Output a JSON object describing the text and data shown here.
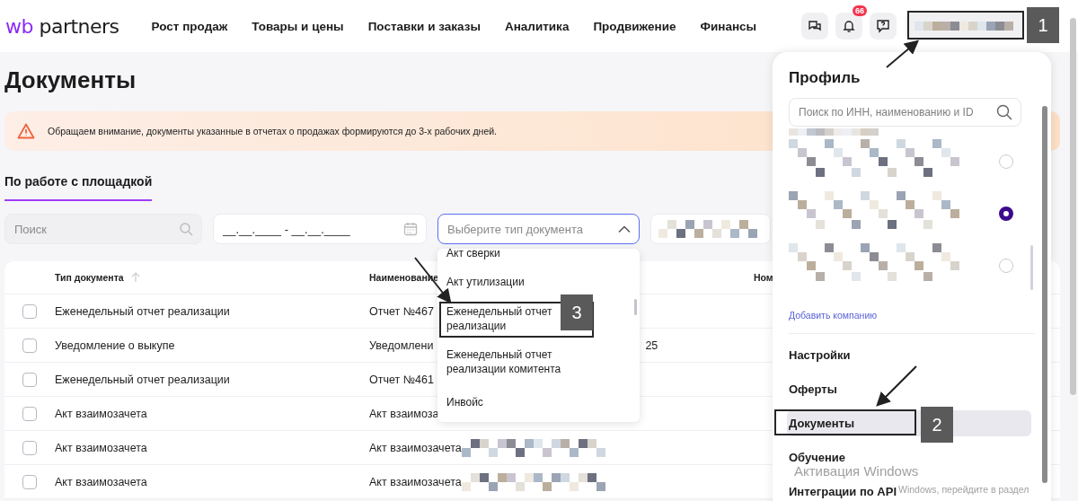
{
  "header": {
    "logo": {
      "mark": "wb",
      "name": "partners"
    },
    "nav": [
      "Рост продаж",
      "Товары и цены",
      "Поставки и заказы",
      "Аналитика",
      "Продвижение",
      "Финансы"
    ],
    "notifications_badge": "66"
  },
  "page": {
    "title": "Документы",
    "notice": "Обращаем внимание, документы указанные в отчетах о продажах формируются до 3-х рабочих дней.",
    "tabs": [
      {
        "label": "По работе с площадкой",
        "selected": true
      }
    ],
    "filters": {
      "search_placeholder": "Поиск",
      "date_placeholder": "__.__.____ - __.__.____",
      "type_placeholder": "Выберите тип документа",
      "type_expanded": true
    },
    "table": {
      "columns": [
        "Тип документа",
        "Наименование",
        "Ном"
      ],
      "rows": [
        {
          "checked": false,
          "type": "Еженедельный отчет реализации",
          "name": "Отчет №467",
          "tail": "",
          "blurred": false
        },
        {
          "checked": false,
          "type": "Уведомление о выкупе",
          "name": "Уведомлени",
          "tail": "25",
          "blurred": false
        },
        {
          "checked": false,
          "type": "Еженедельный отчет реализации",
          "name": "Отчет №461",
          "tail": "",
          "blurred": false
        },
        {
          "checked": false,
          "type": "Акт взаимозачета",
          "name": "Акт взаимоза",
          "tail": "",
          "blurred": false
        },
        {
          "checked": false,
          "type": "Акт взаимозачета",
          "name": "Акт взаимозачета",
          "tail": "",
          "blurred": true
        },
        {
          "checked": false,
          "type": "Акт взаимозачета",
          "name": "Акт взаимозачета",
          "tail": "",
          "blurred": true
        }
      ]
    }
  },
  "type_dropdown": {
    "options": [
      {
        "label": "Акт сверки",
        "selected": false
      },
      {
        "label": "Акт утилизации",
        "selected": false
      },
      {
        "label": "Еженедельный отчет реализации",
        "selected": false
      },
      {
        "label": "Еженедельный отчет реализации комитента",
        "selected": false
      },
      {
        "label": "Инвойс",
        "selected": false
      }
    ]
  },
  "profile": {
    "title": "Профиль",
    "search_placeholder": "Поиск по ИНН, наименованию и ID",
    "companies": [
      {
        "selected": false
      },
      {
        "selected": true
      },
      {
        "selected": false
      }
    ],
    "add_company": "Добавить компанию",
    "menu": [
      {
        "label": "Настройки",
        "selected": false
      },
      {
        "label": "Оферты",
        "selected": false
      },
      {
        "label": "Документы",
        "selected": true
      },
      {
        "label": "Обучение",
        "selected": false
      },
      {
        "label": "Интеграции по API",
        "selected": false
      }
    ]
  },
  "annotations": [
    {
      "label": "1"
    },
    {
      "label": "2"
    },
    {
      "label": "3"
    }
  ],
  "os_overlay": {
    "title": "Активация Windows",
    "hint": "Windows, перейдите в раздел"
  }
}
